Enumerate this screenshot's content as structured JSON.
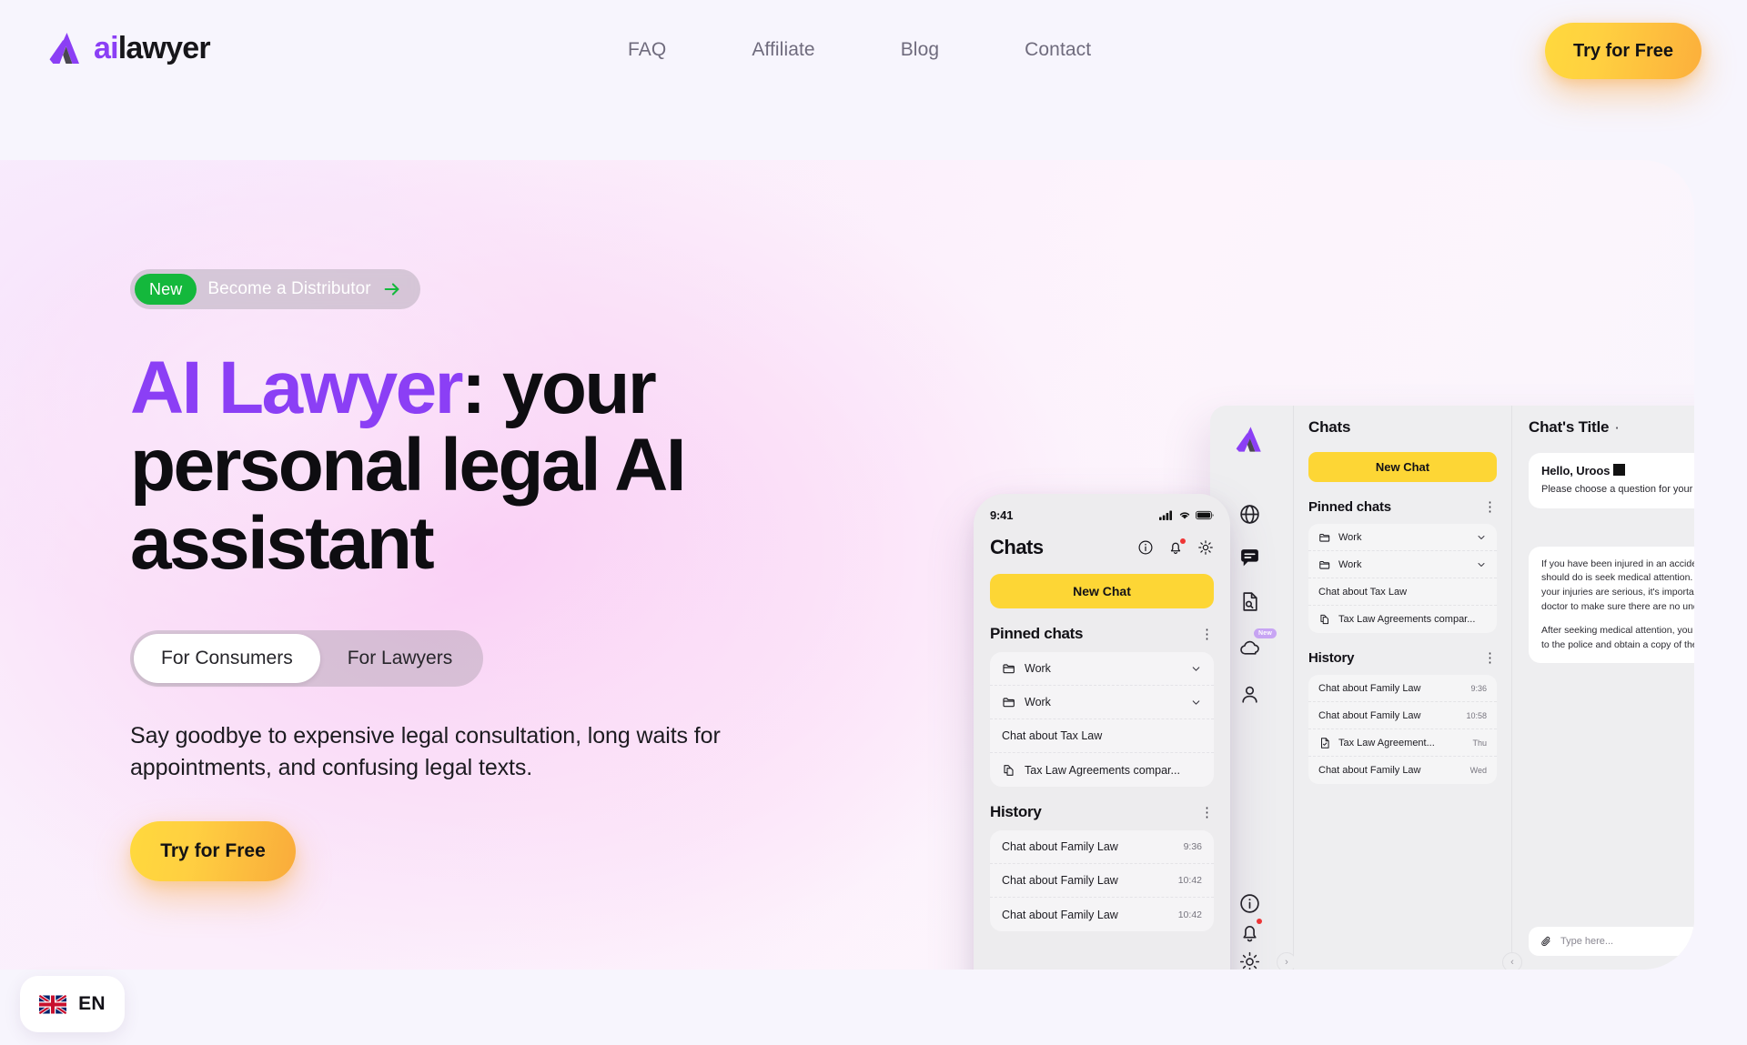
{
  "brand": {
    "logo_ai": "ai",
    "logo_lawyer": "lawyer",
    "accent_purple": "#8b3ff5",
    "accent_yellow": "#fdd635",
    "accent_green": "#14b83c"
  },
  "header": {
    "nav": [
      {
        "label": "FAQ"
      },
      {
        "label": "Affiliate"
      },
      {
        "label": "Blog"
      },
      {
        "label": "Contact"
      }
    ],
    "cta_label": "Try for Free"
  },
  "hero": {
    "badge": {
      "new_label": "New",
      "text": "Become a Distributor",
      "arrow_icon": "arrow-right-icon"
    },
    "headline_accent": "AI Lawyer",
    "headline_rest": ": your personal legal AI assistant",
    "toggle": {
      "options": [
        {
          "label": "For Consumers",
          "active": true
        },
        {
          "label": "For Lawyers",
          "active": false
        }
      ]
    },
    "subtitle": "Say goodbye to expensive legal consultation, long waits for appointments, and confusing legal texts.",
    "cta_label": "Try for Free"
  },
  "phone": {
    "status": {
      "time": "9:41",
      "signal_icon": "cellular-icon",
      "wifi_icon": "wifi-icon",
      "battery_icon": "battery-icon"
    },
    "title": "Chats",
    "header_icons": [
      {
        "name": "info-icon"
      },
      {
        "name": "bell-icon",
        "dot": true
      },
      {
        "name": "sun-icon"
      }
    ],
    "new_chat_label": "New Chat",
    "pinned": {
      "title": "Pinned chats",
      "menu_icon": "kebab-menu-icon",
      "items": [
        {
          "icon": "folder-icon",
          "label": "Work",
          "trailing": "chevron-down-icon"
        },
        {
          "icon": "folder-icon",
          "label": "Work",
          "trailing": "chevron-down-icon"
        },
        {
          "icon": "",
          "label": "Chat about Tax Law",
          "trailing": ""
        },
        {
          "icon": "document-copy-icon",
          "label": "Tax Law Agreements compar...",
          "trailing": ""
        }
      ]
    },
    "history": {
      "title": "History",
      "menu_icon": "kebab-menu-icon",
      "items": [
        {
          "icon": "",
          "label": "Chat about Family Law",
          "time": "9:36"
        },
        {
          "icon": "",
          "label": "Chat about Family Law",
          "time": "10:42"
        },
        {
          "icon": "",
          "label": "Chat about Family Law",
          "time": "10:42"
        }
      ]
    },
    "tabs": [
      {
        "name": "chat-icon",
        "active": true
      },
      {
        "name": "document-search-icon",
        "active": false
      },
      {
        "name": "person-icon",
        "active": false
      },
      {
        "name": "briefcase-icon",
        "active": false
      }
    ]
  },
  "desktop": {
    "rail": [
      {
        "name": "globe-icon"
      },
      {
        "name": "chat-icon",
        "active": true
      },
      {
        "name": "document-search-icon"
      },
      {
        "name": "cloud-icon",
        "badge": "New"
      },
      {
        "name": "person-icon"
      },
      {
        "name": "info-icon"
      },
      {
        "name": "bell-icon",
        "dot": true
      },
      {
        "name": "sun-icon"
      }
    ],
    "expand_icon": "›",
    "collapse_icon": "‹",
    "list": {
      "title": "Chats",
      "new_chat_label": "New Chat",
      "pinned": {
        "title": "Pinned chats",
        "menu_icon": "kebab-menu-icon",
        "items": [
          {
            "icon": "folder-icon",
            "label": "Work",
            "trailing": "chevron-down-icon"
          },
          {
            "icon": "folder-icon",
            "label": "Work",
            "trailing": "chevron-down-icon"
          },
          {
            "icon": "",
            "label": "Chat about Tax Law",
            "trailing": ""
          },
          {
            "icon": "document-copy-icon",
            "label": "Tax Law Agreements compar...",
            "trailing": ""
          }
        ]
      },
      "history": {
        "title": "History",
        "menu_icon": "kebab-menu-icon",
        "items": [
          {
            "icon": "",
            "label": "Chat about Family Law",
            "time": "9:36"
          },
          {
            "icon": "",
            "label": "Chat about Family Law",
            "time": "10:58"
          },
          {
            "icon": "document-check-icon",
            "label": "Tax Law Agreement...",
            "time": "Thu"
          },
          {
            "icon": "",
            "label": "Chat about Family Law",
            "time": "Wed"
          }
        ]
      }
    },
    "chat": {
      "title": "Chat's Title",
      "title_dot": "·",
      "greeting": "Hello, Uroos",
      "greeting_sub": "Please choose a question for your inquiry",
      "message_p1": "If you have been injured in an accident, the first thing you should do is seek medical attention. Even if you don't think your injuries are serious, it's important to get checked out by a doctor to make sure there are no underlying issues.",
      "message_p2": "After seeking medical attention, you should report the accident to the police and obtain a copy of the police report.",
      "input_placeholder": "Type here...",
      "attach_icon": "paperclip-icon"
    }
  },
  "lang": {
    "flag_icon": "uk-flag-icon",
    "code": "EN"
  }
}
